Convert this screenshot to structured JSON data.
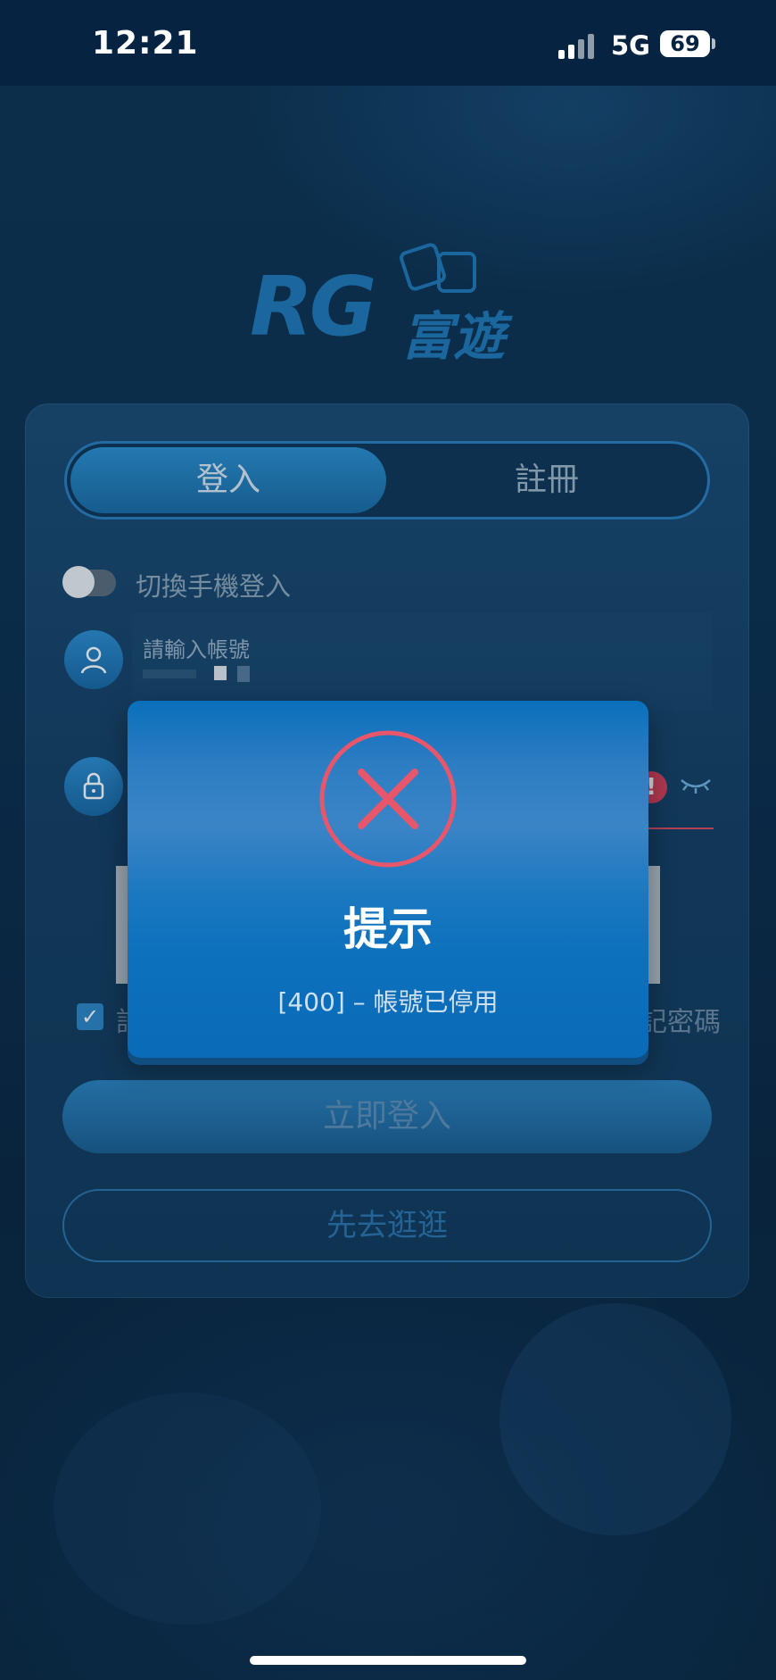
{
  "status_bar": {
    "time": "12:21",
    "network": "5G",
    "battery": "69"
  },
  "logo": {
    "brand": "RG",
    "chinese": "富遊"
  },
  "tabs": {
    "login": "登入",
    "register": "註冊"
  },
  "toggle": {
    "label": "切換手機登入",
    "on": false
  },
  "account_field": {
    "label": "請輸入帳號"
  },
  "password_field": {
    "warning": "!"
  },
  "remember": {
    "checked": true,
    "left_text": "記",
    "right_text": "記密碼"
  },
  "buttons": {
    "login": "立即登入",
    "browse": "先去逛逛"
  },
  "modal": {
    "title": "提示",
    "message": "[400] – 帳號已停用"
  },
  "colors": {
    "accent": "#1f78b8",
    "error": "#e8566c",
    "modal_bg": "#0a6fba"
  }
}
